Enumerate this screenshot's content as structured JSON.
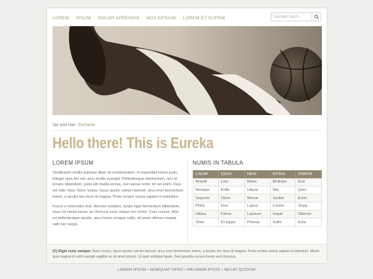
{
  "nav": {
    "items": [
      {
        "label": "LOREM"
      },
      {
        "label": "IPSUM"
      },
      {
        "label": "DOLOR APPENDIS"
      },
      {
        "label": "NOX EPSIUM"
      },
      {
        "label": "LOREM ET SUPEM"
      }
    ]
  },
  "search": {
    "placeholder": "Suchen nach ..."
  },
  "breadcrumb": {
    "prefix": "Sie sind hier:",
    "link": "Startseite"
  },
  "main": {
    "title": "Hello there! This is Eureka"
  },
  "left": {
    "heading": "LOREM IPSUM",
    "para1": "Vestibulum mollis pulvinar diam id condimentum. In imperdiet lorem justo. Integer quis leo nec arcu mollis suscipit. Pellentesque elementum, orci id ornare bibendum, justo elit mattis lectus, non varius tortor mi vel enim. Duis vel odio risus. Nunc luctus, lacus auctor rutrum laoreet, arcu eros fermentum lorem, a iaculis leo risus id magna. Proin ornare varius sapien in interdum.",
    "para2": "Fusce a venenatis erat. Aenean sodales, turpis eget fermentum bibendum, risus mi varius lacus, ac rhoncus nunc neque nec tortor. Cras cursus, felis eu pellentesque iaculis, arcu lorem congue nulla, sit amet ultrices massa velit nec turpis."
  },
  "right": {
    "heading": "NUMIS IN TABULA",
    "table": {
      "headers": [
        "LISUM",
        "IQUIS",
        "NEIS",
        "EPSUL",
        "ONKOK"
      ],
      "rows": [
        [
          "Aramli",
          "Lolu",
          "Mlooi",
          "Mollopo",
          "Euli"
        ],
        [
          "Nonque",
          "Kolle",
          "Ulquis",
          "Niq",
          "Quis"
        ],
        [
          "Seprem",
          "Olem",
          "Morus",
          "Sedde",
          "Exim"
        ],
        [
          "Phila",
          "Inxs",
          "Lupus",
          "Lorem",
          "Sepp"
        ],
        [
          "Inktus",
          "Fahra",
          "Lepsum",
          "Inquit",
          "Oberon"
        ],
        [
          "Sixtu",
          "Et loppo",
          "Primus",
          "Sollo",
          "Exta"
        ]
      ]
    }
  },
  "footer": {
    "copyright": "(C) Elgin nunc semper.",
    "text": "Nunc luctus, lacus auctor rutrum laoreet, arcu eros fermentum lorem, a iaculis leo risus id magna. Proin ornare varius sapien in interdum. Morbi quis magna id velit suscipit sagittis ac sit amet ipsum. Ut quis volutpat ligule. Sed gravida cursus lorem sed rhoncus."
  },
  "bottom_links": [
    "LOREM IPSUM",
    "NUMQUAT OPSO",
    "PALUREM IPSOS",
    "NECAT QUIDOM"
  ],
  "colors": {
    "accent": "#c7b58d",
    "nav_link": "#a39a72",
    "table_header": "#8e8670"
  }
}
